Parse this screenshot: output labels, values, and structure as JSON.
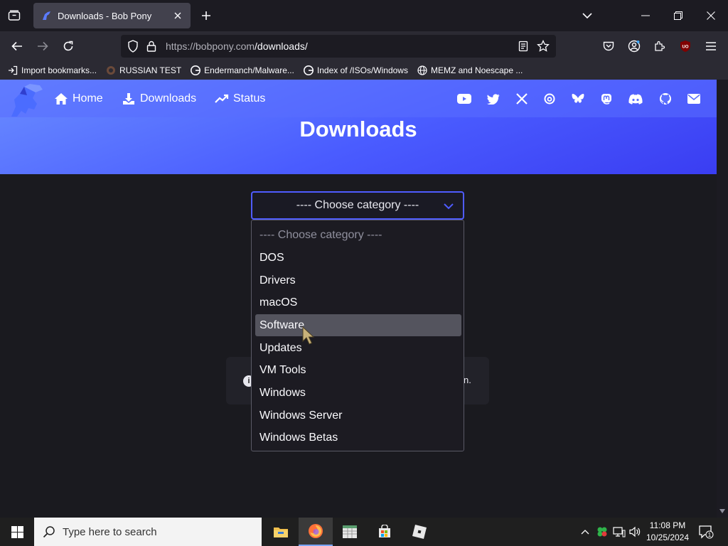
{
  "browser": {
    "tab_title": "Downloads - Bob Pony",
    "url_host": "https://bobpony.com",
    "url_path": "/downloads/",
    "addon_badge": "UO"
  },
  "bookmarks": [
    {
      "label": "Import bookmarks...",
      "icon": "import-icon"
    },
    {
      "label": "RUSSIAN TEST",
      "icon": "site-icon"
    },
    {
      "label": "Endermanch/Malware...",
      "icon": "google-icon"
    },
    {
      "label": "Index of /ISOs/Windows",
      "icon": "google-icon"
    },
    {
      "label": "MEMZ and Noescape ...",
      "icon": "globe-icon"
    }
  ],
  "site": {
    "nav": [
      {
        "label": "Home",
        "icon": "home-icon"
      },
      {
        "label": "Downloads",
        "icon": "download-icon"
      },
      {
        "label": "Status",
        "icon": "trend-icon"
      }
    ],
    "social_icons": [
      "youtube-icon",
      "twitter-icon",
      "x-icon",
      "threads-icon",
      "bluesky-icon",
      "mastodon-icon",
      "discord-icon",
      "github-icon",
      "mail-icon"
    ],
    "hero_title": "Downloads",
    "select_value": "---- Choose category ----",
    "notice_tail": "n."
  },
  "dropdown": {
    "options": [
      "---- Choose category ----",
      "DOS",
      "Drivers",
      "macOS",
      "Software",
      "Updates",
      "VM Tools",
      "Windows",
      "Windows Server",
      "Windows Betas"
    ],
    "highlighted": "Software"
  },
  "taskbar": {
    "search_placeholder": "Type here to search",
    "time": "11:08 PM",
    "date": "10/25/2024",
    "notification_count": "1"
  },
  "colors": {
    "accent": "#4f5cff",
    "hero_start": "#6a8dff",
    "hero_end": "#3a3df2"
  }
}
